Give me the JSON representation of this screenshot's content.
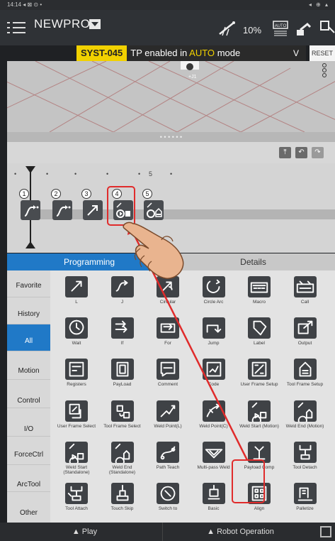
{
  "status_bar": {
    "time": "14:14",
    "icons": "◂ ⊠ ⊙ •",
    "right_icons": "◂ ⊕ ▴"
  },
  "toolbar": {
    "program_name": "NEWPROG",
    "speed": "10%",
    "auto_label": "AUTO"
  },
  "alarm": {
    "code": "SYST-045",
    "message_prefix": "TP enabled in",
    "message_mode": "AUTO",
    "message_suffix": "mode",
    "expand_label": "V",
    "reset_label": "RESET"
  },
  "view3d": {
    "frame_label": "+J1",
    "divider_label": "• • • • • •"
  },
  "timeline": {
    "ruler_mark": "5",
    "steps": [
      "1",
      "2",
      "3",
      "4",
      "5"
    ]
  },
  "tabs": {
    "programming": "Programming",
    "details": "Details"
  },
  "categories": [
    "Favorite",
    "History",
    "All",
    "Motion",
    "Control",
    "I/O",
    "ForceCtrl",
    "ArcTool",
    "Other"
  ],
  "active_category": "All",
  "palette": [
    "L",
    "J",
    "Circular",
    "Circle Arc",
    "Macro",
    "Call",
    "Wait",
    "If",
    "For",
    "Jump",
    "Label",
    "Output",
    "Registers",
    "PayLoad",
    "Comment",
    "Code",
    "User Frame Setup",
    "Tool Frame Setup",
    "User Frame Select",
    "Tool Frame Select",
    "Weld Point(L)",
    "Weld Point(C)",
    "Weld Start (Motion)",
    "Weld End (Motion)",
    "Weld Start (Standalone)",
    "Weld End (Standalone)",
    "Path Teach",
    "Multi-pass Weld",
    "Payload Comp",
    "Tool Detach",
    "Tool Attach",
    "Touch Skip",
    "Switch to",
    "Basic",
    "Align",
    "Palletize"
  ],
  "bottom_bar": {
    "play": "▲ Play",
    "robot_operation": "▲ Robot Operation"
  },
  "colors": {
    "accent": "#2079c7",
    "alarm": "#f1d100",
    "highlight": "#e02b2b"
  }
}
